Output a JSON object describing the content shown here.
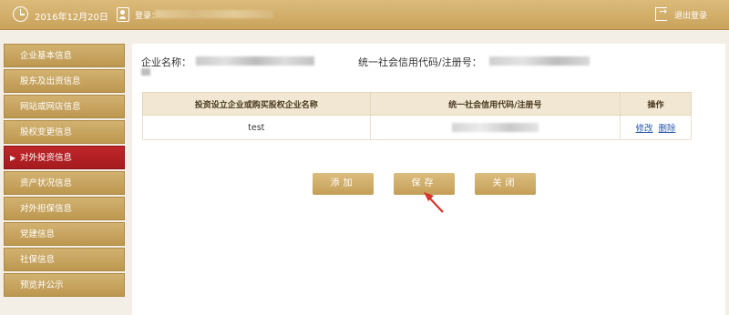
{
  "header": {
    "date": "2016年12月20日",
    "login_prefix": "登录：",
    "logout_label": "退出登录"
  },
  "sidebar": {
    "items": [
      {
        "label": "企业基本信息",
        "active": false
      },
      {
        "label": "股东及出资信息",
        "active": false
      },
      {
        "label": "网站或网店信息",
        "active": false
      },
      {
        "label": "股权变更信息",
        "active": false
      },
      {
        "label": "对外投资信息",
        "active": true
      },
      {
        "label": "资产状况信息",
        "active": false
      },
      {
        "label": "对外担保信息",
        "active": false
      },
      {
        "label": "党建信息",
        "active": false
      },
      {
        "label": "社保信息",
        "active": false
      },
      {
        "label": "预览并公示",
        "active": false
      }
    ]
  },
  "main": {
    "company_name_label": "企业名称：",
    "credit_code_label": "统一社会信用代码/注册号："
  },
  "table": {
    "headers": [
      "投资设立企业或购买股权企业名称",
      "统一社会信用代码/注册号",
      "操作"
    ],
    "rows": [
      {
        "name": "test",
        "code": "",
        "edit": "修改",
        "delete": "删除"
      }
    ]
  },
  "buttons": {
    "add": "添加",
    "save": "保存",
    "close": "关闭"
  },
  "colors": {
    "accent_gold": "#c9a35c",
    "active_red": "#b5201f",
    "link_blue": "#2b5aa8"
  }
}
